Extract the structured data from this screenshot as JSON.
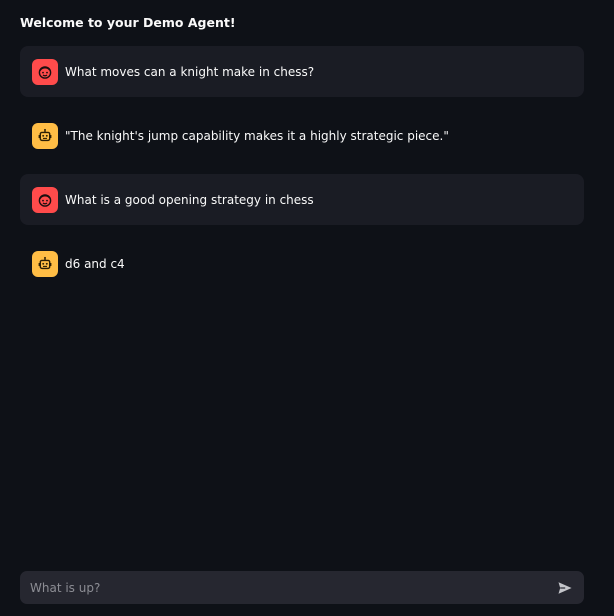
{
  "header": {
    "title": "Welcome to your Demo Agent!"
  },
  "messages": [
    {
      "role": "user",
      "icon": "face-icon",
      "text": "What moves can a knight make in chess?"
    },
    {
      "role": "assistant",
      "icon": "robot-icon",
      "text": "\"The knight's jump capability makes it a highly strategic piece.\""
    },
    {
      "role": "user",
      "icon": "face-icon",
      "text": "What is a good opening strategy in chess"
    },
    {
      "role": "assistant",
      "icon": "robot-icon",
      "text": "d6 and c4"
    }
  ],
  "chat_input": {
    "placeholder": "What is up?",
    "value": "",
    "send_icon": "send-icon"
  },
  "colors": {
    "background": "#0e1117",
    "user_bubble": "#1a1c24",
    "user_avatar": "#ff4b4b",
    "assistant_avatar": "#ffbd45",
    "input_background": "#262730"
  }
}
